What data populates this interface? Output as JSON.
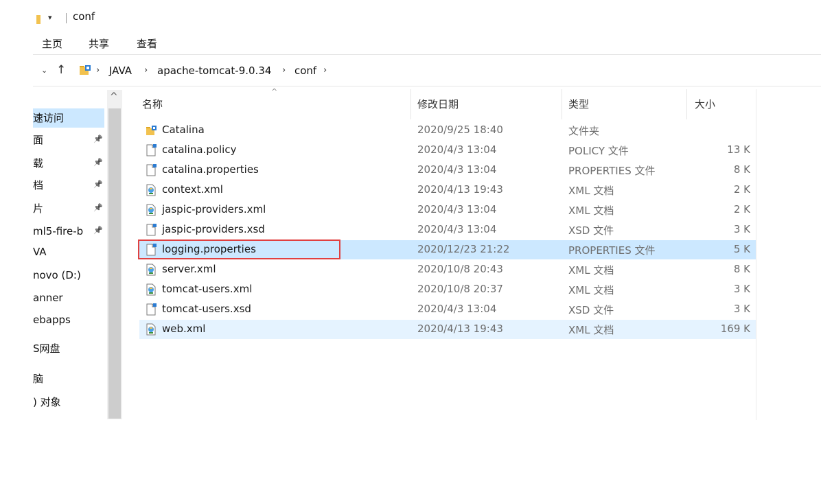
{
  "window": {
    "title": "conf"
  },
  "ribbon": {
    "tabs": [
      "主页",
      "共享",
      "查看"
    ]
  },
  "address": {
    "crumbs": [
      "JAVA",
      "apache-tomcat-9.0.34",
      "conf"
    ]
  },
  "nav": {
    "items": [
      {
        "label": "速访问",
        "pinned": false,
        "selected": true
      },
      {
        "label": "面",
        "pinned": true
      },
      {
        "label": "载",
        "pinned": true
      },
      {
        "label": "档",
        "pinned": true
      },
      {
        "label": "片",
        "pinned": true
      },
      {
        "label": "ml5-fire-b",
        "pinned": true
      },
      {
        "label": "VA",
        "pinned": false
      },
      {
        "label": "novo (D:)",
        "pinned": false
      },
      {
        "label": "anner",
        "pinned": false
      },
      {
        "label": "ebapps",
        "pinned": false
      },
      {
        "label": "S网盘",
        "pinned": false
      },
      {
        "label": "脑",
        "pinned": false
      },
      {
        "label": ") 对象",
        "pinned": false
      }
    ]
  },
  "columns": {
    "name": "名称",
    "date": "修改日期",
    "type": "类型",
    "size": "大小"
  },
  "files": [
    {
      "name": "Catalina",
      "date": "2020/9/25 18:40",
      "type": "文件夹",
      "size": "",
      "icon": "folder-icon"
    },
    {
      "name": "catalina.policy",
      "date": "2020/4/3 13:04",
      "type": "POLICY 文件",
      "size": "13 K",
      "icon": "file-icon"
    },
    {
      "name": "catalina.properties",
      "date": "2020/4/3 13:04",
      "type": "PROPERTIES 文件",
      "size": "8 K",
      "icon": "file-icon"
    },
    {
      "name": "context.xml",
      "date": "2020/4/13 19:43",
      "type": "XML 文档",
      "size": "2 K",
      "icon": "xml-icon"
    },
    {
      "name": "jaspic-providers.xml",
      "date": "2020/4/3 13:04",
      "type": "XML 文档",
      "size": "2 K",
      "icon": "xml-icon"
    },
    {
      "name": "jaspic-providers.xsd",
      "date": "2020/4/3 13:04",
      "type": "XSD 文件",
      "size": "3 K",
      "icon": "file-icon"
    },
    {
      "name": "logging.properties",
      "date": "2020/12/23 21:22",
      "type": "PROPERTIES 文件",
      "size": "5 K",
      "icon": "file-icon",
      "state": "selected"
    },
    {
      "name": "server.xml",
      "date": "2020/10/8 20:43",
      "type": "XML 文档",
      "size": "8 K",
      "icon": "xml-icon"
    },
    {
      "name": "tomcat-users.xml",
      "date": "2020/10/8 20:37",
      "type": "XML 文档",
      "size": "3 K",
      "icon": "xml-icon"
    },
    {
      "name": "tomcat-users.xsd",
      "date": "2020/4/3 13:04",
      "type": "XSD 文件",
      "size": "3 K",
      "icon": "file-icon"
    },
    {
      "name": "web.xml",
      "date": "2020/4/13 19:43",
      "type": "XML 文档",
      "size": "169 K",
      "icon": "xml-icon",
      "state": "hover"
    }
  ],
  "colors": {
    "selected_row": "#cce8ff",
    "hover_row": "#e5f3ff",
    "highlight_box": "#e04040",
    "folder": "#f2c24f"
  }
}
